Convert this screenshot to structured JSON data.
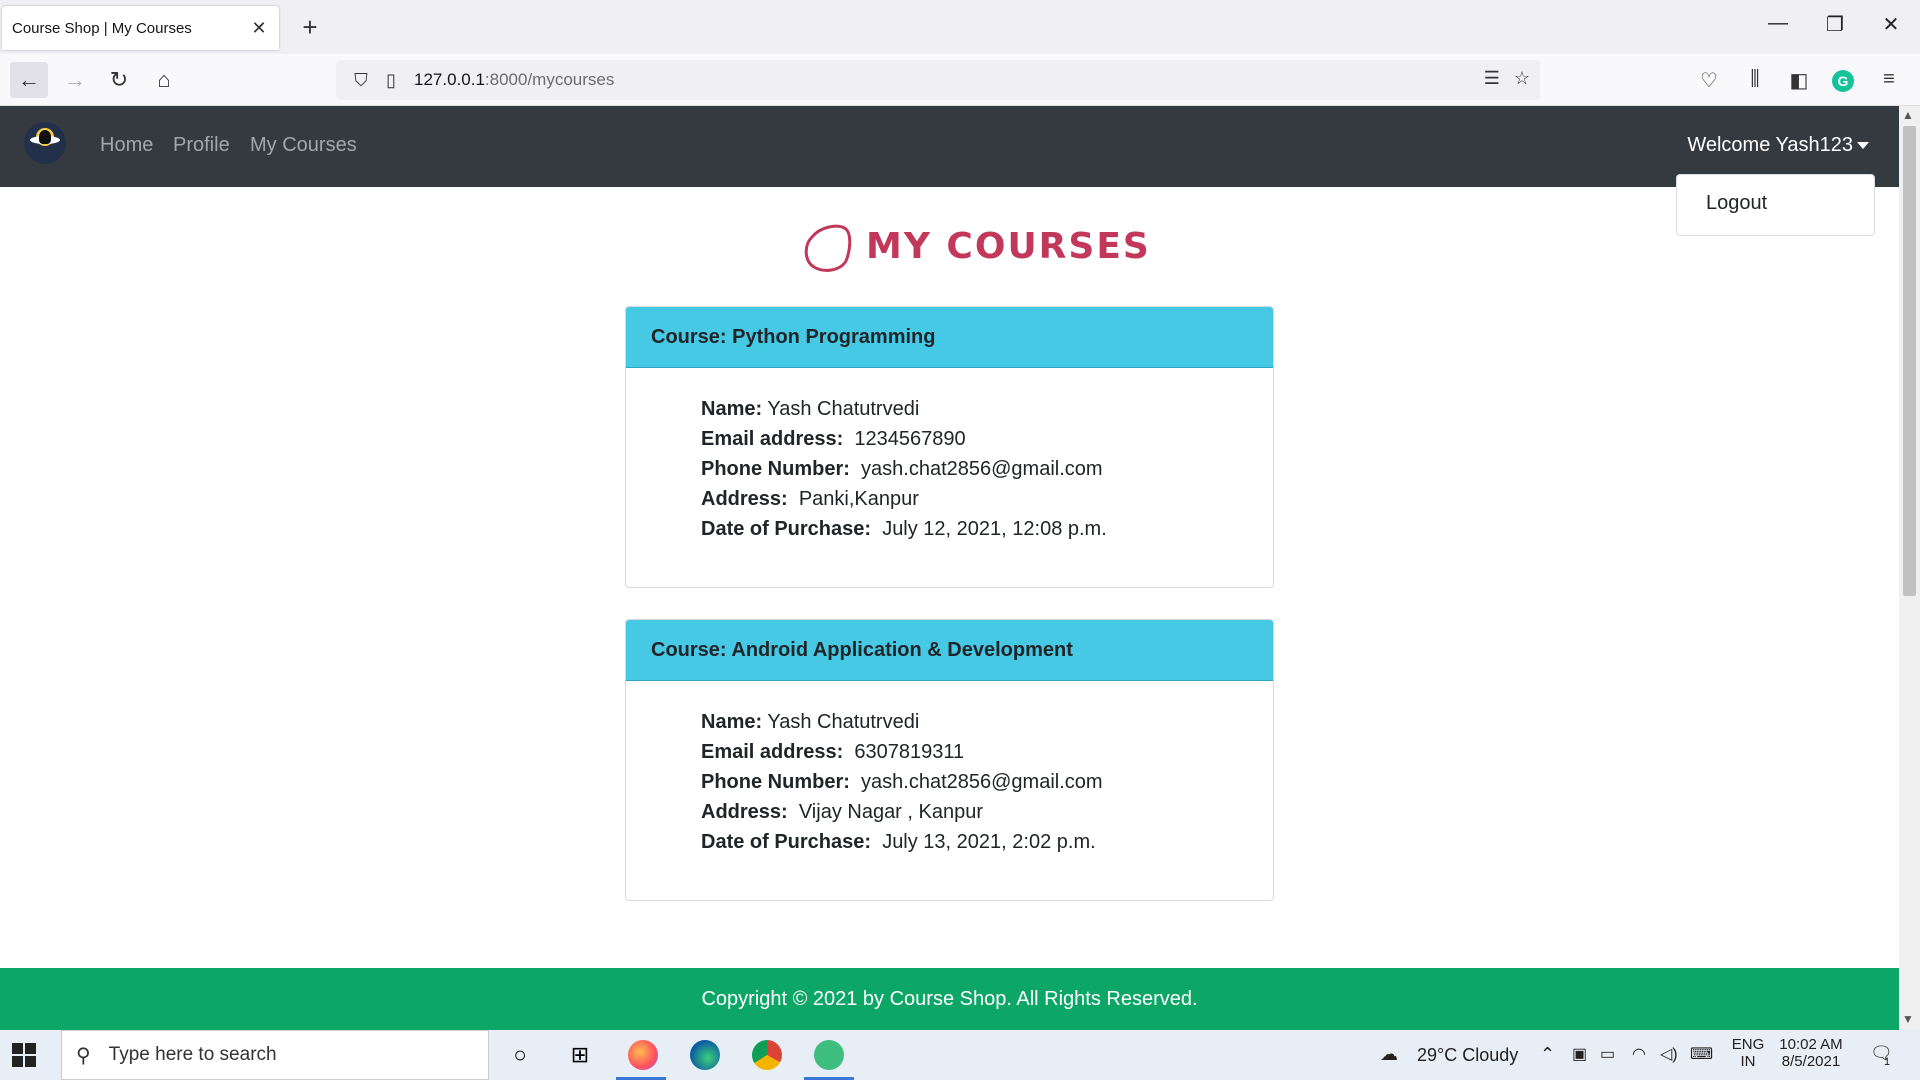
{
  "browser": {
    "tab_title": "Course Shop | My Courses",
    "tab_close": "✕",
    "new_tab": "+",
    "url_host": "127.0.0.1",
    "url_path": ":8000/mycourses",
    "win_minimize": "—",
    "win_restore": "❐",
    "win_close": "✕"
  },
  "site": {
    "nav": {
      "home": "Home",
      "profile": "Profile",
      "my_courses": "My Courses",
      "welcome": "Welcome Yash123"
    },
    "dropdown": {
      "logout": "Logout"
    },
    "heading": "MY COURSES",
    "courses": [
      {
        "header": "Course: Python Programming",
        "name_label": "Name:",
        "name": "Yash Chatutrvedi",
        "email_label": "Email address:",
        "email": "1234567890",
        "phone_label": "Phone Number:",
        "phone": "yash.chat2856@gmail.com",
        "address_label": "Address:",
        "address": "Panki,Kanpur",
        "date_label": "Date of Purchase:",
        "date": "July 12, 2021, 12:08 p.m."
      },
      {
        "header": "Course: Android Application & Development",
        "name_label": "Name:",
        "name": "Yash Chatutrvedi",
        "email_label": "Email address:",
        "email": "6307819311",
        "phone_label": "Phone Number:",
        "phone": "yash.chat2856@gmail.com",
        "address_label": "Address:",
        "address": "Vijay Nagar , Kanpur",
        "date_label": "Date of Purchase:",
        "date": "July 13, 2021, 2:02 p.m."
      }
    ],
    "footer": "Copyright © 2021 by Course Shop. All Rights Reserved."
  },
  "taskbar": {
    "search_placeholder": "Type here to search",
    "weather": "29°C  Cloudy",
    "lang_top": "ENG",
    "lang_bottom": "IN",
    "time": "10:02 AM",
    "date": "8/5/2021",
    "notification_count": "1"
  },
  "colors": {
    "navbar": "#343a40",
    "card_header": "#45c9e4",
    "footer": "#0ca766",
    "heading": "#c2385a"
  }
}
